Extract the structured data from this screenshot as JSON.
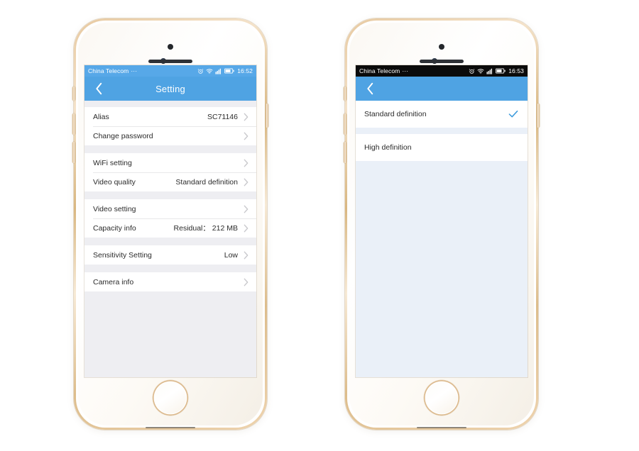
{
  "meta": {
    "scene": "Two gold iPhone mockups showing an IP camera app Setting screen and a video-quality chooser",
    "colors": {
      "nav_blue": "#4fa3e3",
      "status_blue": "#57a8e8",
      "status_black": "#0b0b0b",
      "check_blue": "#3d9bdc",
      "page_gray": "#eeeef2",
      "page_blue_gray": "#eaf0f8",
      "row_white": "#ffffff",
      "text_dark": "#2b2b2b",
      "chevron_gray": "#c8c8cc",
      "bezel_gold": "#dcbd92"
    }
  },
  "phone_left": {
    "status": {
      "carrier": "China Telecom",
      "carrier_dots": "···",
      "time": "16:52",
      "icons": [
        "alarm-icon",
        "wifi-icon",
        "signal-icon",
        "battery-icon"
      ]
    },
    "navbar": {
      "back": "back-chevron-icon",
      "title": "Setting"
    },
    "groups": [
      {
        "rows": [
          {
            "label": "Alias",
            "value": "SC71146"
          },
          {
            "label": "Change password",
            "value": ""
          }
        ]
      },
      {
        "rows": [
          {
            "label": "WiFi setting",
            "value": ""
          },
          {
            "label": "Video quality",
            "value": "Standard definition"
          }
        ]
      },
      {
        "rows": [
          {
            "label": "Video setting",
            "value": ""
          },
          {
            "label": "Capacity info",
            "value": "Residual： 212 MB"
          }
        ]
      },
      {
        "rows": [
          {
            "label": "Sensitivity Setting",
            "value": "Low"
          }
        ]
      },
      {
        "rows": [
          {
            "label": "Camera info",
            "value": ""
          }
        ]
      }
    ]
  },
  "phone_right": {
    "status": {
      "carrier": "China Telecom",
      "carrier_dots": "···",
      "time": "16:53",
      "icons": [
        "alarm-icon",
        "wifi-icon",
        "signal-icon",
        "battery-icon"
      ]
    },
    "navbar": {
      "back": "back-chevron-icon",
      "title": ""
    },
    "options": [
      {
        "label": "Standard definition",
        "selected": true
      },
      {
        "label": "High definition",
        "selected": false
      }
    ]
  }
}
